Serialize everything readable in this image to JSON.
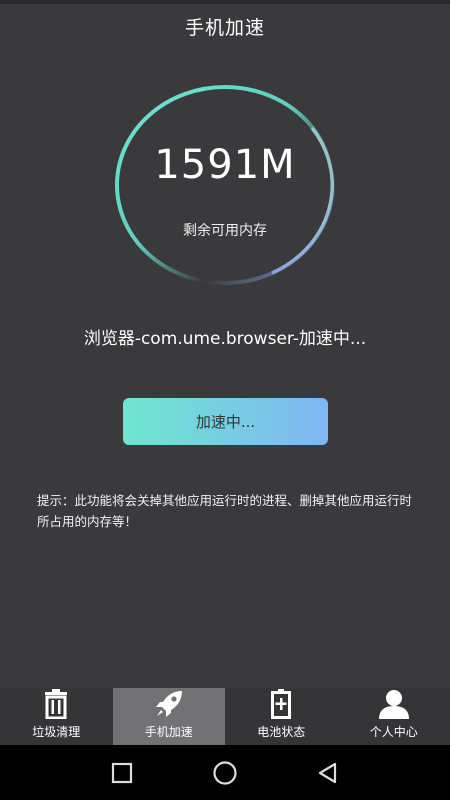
{
  "header": {
    "title": "手机加速"
  },
  "memory": {
    "value": "1591M",
    "label": "剩余可用内存"
  },
  "process": {
    "text": "浏览器-com.ume.browser-加速中..."
  },
  "boost_button": {
    "label": "加速中..."
  },
  "tip": {
    "text": "提示：此功能将会关掉其他应用运行时的进程、删掉其他应用运行时所占用的内存等！"
  },
  "tabs": [
    {
      "label": "垃圾清理",
      "icon": "trash-icon",
      "active": false
    },
    {
      "label": "手机加速",
      "icon": "rocket-icon",
      "active": true
    },
    {
      "label": "电池状态",
      "icon": "battery-icon",
      "active": false
    },
    {
      "label": "个人中心",
      "icon": "person-icon",
      "active": false
    }
  ],
  "navbar": {
    "buttons": [
      "recent-apps-icon",
      "home-icon",
      "back-icon"
    ]
  },
  "colors": {
    "background": "#3a393c",
    "accent_start": "#6ee6cf",
    "accent_end": "#7fb6f4",
    "tab_active": "#727173"
  }
}
